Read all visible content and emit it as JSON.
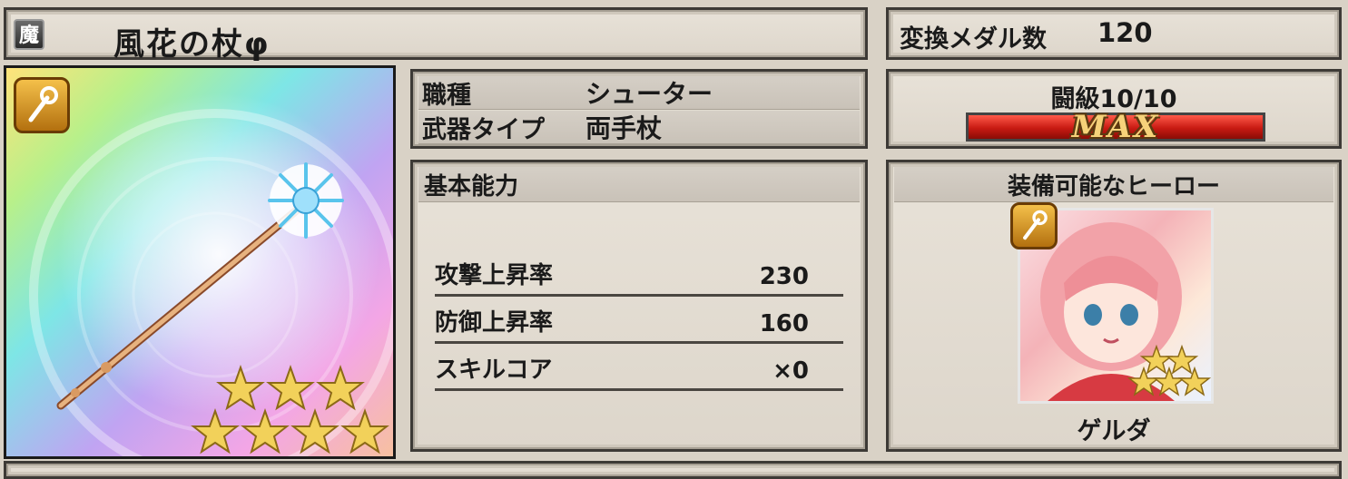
{
  "header": {
    "element_badge": "魔",
    "weapon_name": "風花の杖φ"
  },
  "medal": {
    "label": "変換メダル数",
    "value": "120"
  },
  "info": {
    "class_label": "職種",
    "class_value": "シューター",
    "type_label": "武器タイプ",
    "type_value": "両手杖"
  },
  "awaken": {
    "label": "闘級10/10",
    "max_text": "MAX",
    "level_fraction": 1.0
  },
  "stats": {
    "title": "基本能力",
    "rows": [
      {
        "label": "攻撃上昇率",
        "value": "230"
      },
      {
        "label": "防御上昇率",
        "value": "160"
      },
      {
        "label": "スキルコア",
        "value": "×0"
      }
    ]
  },
  "heroes": {
    "title": "装備可能なヒーロー",
    "hero_name": "ゲルダ",
    "hero_rarity": 5
  },
  "weapon": {
    "rarity": 7,
    "icon": "staff-icon"
  },
  "colors": {
    "star": "#f2d15a",
    "max_bar": "#d21f14",
    "type_icon": "#d99623"
  }
}
